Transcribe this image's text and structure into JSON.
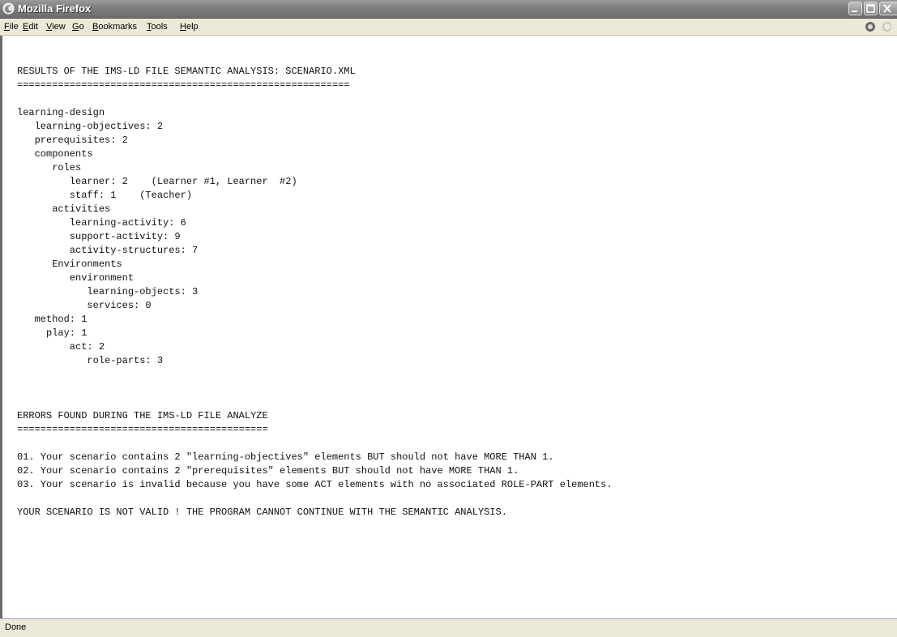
{
  "window": {
    "title": "Mozilla Firefox",
    "controls": [
      "minimize-icon",
      "maximize-icon",
      "close-icon"
    ]
  },
  "menubar": {
    "items": [
      {
        "label": "File",
        "accel": "F",
        "rest": "ile"
      },
      {
        "label": "Edit",
        "accel": "E",
        "rest": "dit"
      },
      {
        "label": "View",
        "accel": "V",
        "rest": "iew"
      },
      {
        "label": "Go",
        "accel": "G",
        "rest": "o"
      },
      {
        "label": "Bookmarks",
        "accel": "B",
        "rest": "ookmarks"
      },
      {
        "label": "Tools",
        "accel": "T",
        "rest": "ools"
      },
      {
        "label": "Help",
        "accel": "H",
        "rest": "elp"
      }
    ]
  },
  "document": {
    "report_title": "RESULTS OF THE IMS-LD FILE SEMANTIC ANALYSIS: SCENARIO.XML",
    "title_rule": "=========================================================",
    "tree": [
      "learning-design",
      "   learning-objectives: 2",
      "   prerequisites: 2",
      "   components",
      "      roles",
      "         learner: 2    (Learner #1, Learner  #2)",
      "         staff: 1    (Teacher)",
      "      activities",
      "         learning-activity: 6",
      "         support-activity: 9",
      "         activity-structures: 7",
      "      Environments",
      "         environment",
      "            learning-objects: 3",
      "            services: 0",
      "   method: 1",
      "     play: 1",
      "         act: 2",
      "            role-parts: 3"
    ],
    "errors_title": "ERRORS FOUND DURING THE IMS-LD FILE ANALYZE",
    "errors_rule": "===========================================",
    "errors": [
      "01. Your scenario contains 2 \"learning-objectives\" elements BUT should not have MORE THAN 1.",
      "02. Your scenario contains 2 \"prerequisites\" elements BUT should not have MORE THAN 1.",
      "03. Your scenario is invalid because you have some ACT elements with no associated ROLE-PART elements."
    ],
    "conclusion": "YOUR SCENARIO IS NOT VALID ! THE PROGRAM CANNOT CONTINUE WITH THE SEMANTIC ANALYSIS."
  },
  "statusbar": {
    "text": "Done"
  },
  "icons": {
    "app": "firefox-icon",
    "status_throbber": "throbber-icon"
  }
}
